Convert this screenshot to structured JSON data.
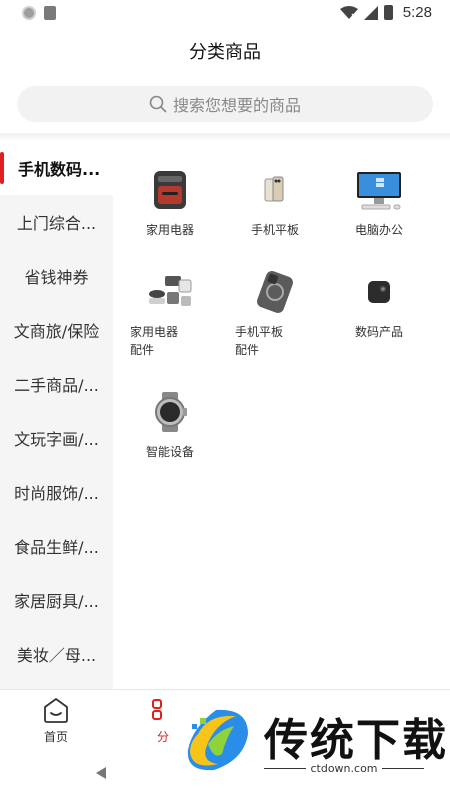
{
  "status_bar": {
    "time": "5:28"
  },
  "header": {
    "title": "分类商品"
  },
  "search": {
    "placeholder": "搜索您想要的商品"
  },
  "sidebar": {
    "items": [
      {
        "label": "手机数码..."
      },
      {
        "label": "上门综合..."
      },
      {
        "label": "省钱神券"
      },
      {
        "label": "文商旅/保险"
      },
      {
        "label": "二手商品/..."
      },
      {
        "label": "文玩字画/..."
      },
      {
        "label": "时尚服饰/..."
      },
      {
        "label": "食品生鲜/..."
      },
      {
        "label": "家居厨具/..."
      },
      {
        "label": "美妆／母..."
      }
    ]
  },
  "categories": [
    {
      "label": "家用电器",
      "icon": "air-fryer-icon"
    },
    {
      "label": "手机平板",
      "icon": "phone-icon"
    },
    {
      "label": "电脑办公",
      "icon": "computer-icon"
    },
    {
      "label": "家用电器配件",
      "icon": "appliance-parts-icon"
    },
    {
      "label": "手机平板配件",
      "icon": "phone-case-icon"
    },
    {
      "label": "数码产品",
      "icon": "camera-icon"
    },
    {
      "label": "智能设备",
      "icon": "smartwatch-icon"
    }
  ],
  "bottom_nav": {
    "home_label": "首页",
    "category_label": "分"
  },
  "watermark": {
    "name": "传统下载",
    "url": "ctdown.com"
  },
  "colors": {
    "accent": "#e02020",
    "sidebar_bg": "#f5f5f5",
    "search_bg": "#f2f2f2"
  }
}
